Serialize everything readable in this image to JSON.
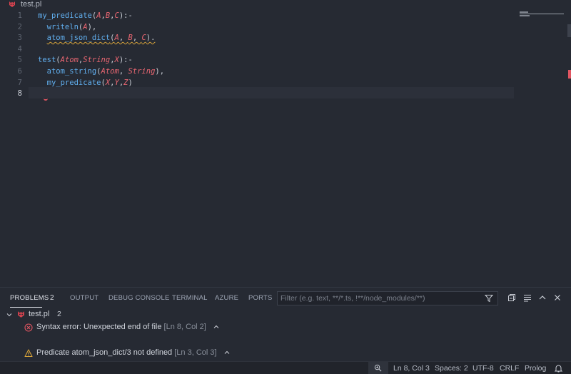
{
  "window": {
    "title": "test.pl"
  },
  "editor": {
    "line_numbers": [
      "1",
      "2",
      "3",
      "4",
      "5",
      "6",
      "7",
      "8"
    ],
    "active_line": "8",
    "lines": [
      [
        {
          "t": "my_predicate",
          "c": "fn"
        },
        {
          "t": "(",
          "c": "punc"
        },
        {
          "t": "A",
          "c": "var"
        },
        {
          "t": ",",
          "c": "punc"
        },
        {
          "t": "B",
          "c": "var"
        },
        {
          "t": ",",
          "c": "punc"
        },
        {
          "t": "C",
          "c": "var"
        },
        {
          "t": "):-",
          "c": "punc"
        }
      ],
      [
        {
          "t": "  writeln",
          "c": "fn"
        },
        {
          "t": "(",
          "c": "punc"
        },
        {
          "t": "A",
          "c": "var"
        },
        {
          "t": "),",
          "c": "punc"
        }
      ],
      [
        {
          "t": "  atom_json_dict",
          "c": "fn",
          "w": true
        },
        {
          "t": "(",
          "c": "punc",
          "w": true
        },
        {
          "t": "A",
          "c": "var",
          "w": true
        },
        {
          "t": ", ",
          "c": "punc",
          "w": true
        },
        {
          "t": "B",
          "c": "var",
          "w": true
        },
        {
          "t": ", ",
          "c": "punc",
          "w": true
        },
        {
          "t": "C",
          "c": "var",
          "w": true
        },
        {
          "t": ").",
          "c": "punc",
          "w": true
        }
      ],
      [],
      [
        {
          "t": "test",
          "c": "fn"
        },
        {
          "t": "(",
          "c": "punc"
        },
        {
          "t": "Atom",
          "c": "var"
        },
        {
          "t": ",",
          "c": "punc"
        },
        {
          "t": "String",
          "c": "var"
        },
        {
          "t": ",",
          "c": "punc"
        },
        {
          "t": "X",
          "c": "var"
        },
        {
          "t": "):-",
          "c": "punc"
        }
      ],
      [
        {
          "t": "  atom_string",
          "c": "fn"
        },
        {
          "t": "(",
          "c": "punc"
        },
        {
          "t": "Atom",
          "c": "var"
        },
        {
          "t": ", ",
          "c": "punc"
        },
        {
          "t": "String",
          "c": "var"
        },
        {
          "t": "),",
          "c": "punc"
        }
      ],
      [
        {
          "t": "  my_predicate",
          "c": "fn"
        },
        {
          "t": "(",
          "c": "punc"
        },
        {
          "t": "X",
          "c": "var"
        },
        {
          "t": ",",
          "c": "punc"
        },
        {
          "t": "Y",
          "c": "var"
        },
        {
          "t": ",",
          "c": "punc"
        },
        {
          "t": "Z",
          "c": "var"
        },
        {
          "t": ")",
          "c": "punc"
        }
      ],
      []
    ]
  },
  "panel": {
    "tabs": [
      {
        "label": "PROBLEMS",
        "active": true
      },
      {
        "label": "OUTPUT"
      },
      {
        "label": "DEBUG CONSOLE"
      },
      {
        "label": "TERMINAL"
      },
      {
        "label": "AZURE"
      },
      {
        "label": "PORTS"
      }
    ],
    "problems_count": "2",
    "filter_placeholder": "Filter (e.g. text, **/*.ts, !**/node_modules/**)",
    "file": {
      "name": "test.pl",
      "count": "2"
    },
    "problems": [
      {
        "severity": "error",
        "message": "Syntax error: Unexpected end of file",
        "location": "[Ln 8, Col 2]"
      },
      {
        "severity": "warning",
        "message": "Predicate atom_json_dict/3 not defined",
        "location": "[Ln 3, Col 3]"
      }
    ]
  },
  "statusbar": {
    "position": "Ln 8, Col 3",
    "spaces": "Spaces: 2",
    "encoding": "UTF-8",
    "eol": "CRLF",
    "language": "Prolog"
  },
  "colors": {
    "background": "#262a33",
    "function": "#61afef",
    "variable": "#e86671",
    "error": "#e05561",
    "warning": "#d7a33a"
  }
}
